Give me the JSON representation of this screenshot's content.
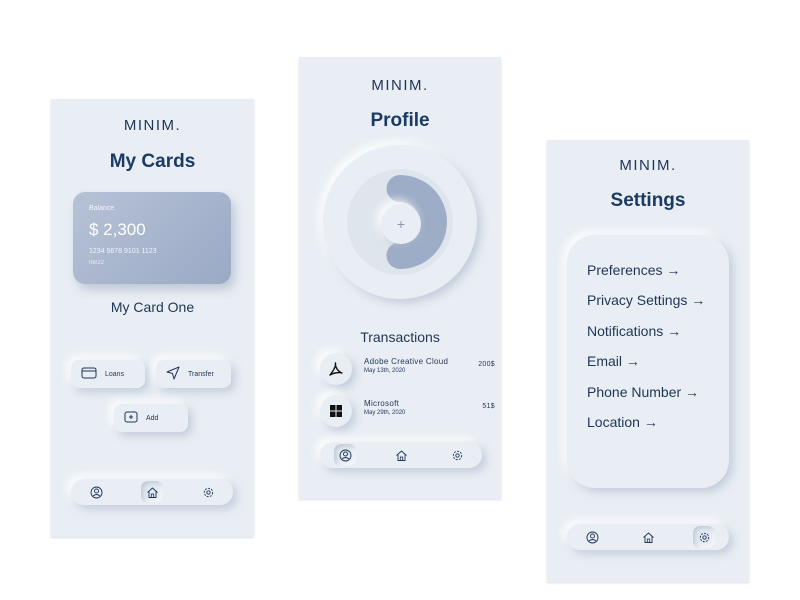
{
  "brand": "MINIM.",
  "cards_screen": {
    "title": "My Cards",
    "card": {
      "balance_label": "Balance",
      "balance_value": "$ 2,300",
      "number": "1234 5678 9101 1123",
      "expiry": "08/22"
    },
    "card_name": "My Card One",
    "buttons": {
      "loans": "Loans",
      "transfer": "Transfer",
      "add": "Add"
    }
  },
  "profile_screen": {
    "title": "Profile",
    "donut_fraction": 0.5,
    "transactions_title": "Transactions",
    "transactions": [
      {
        "name": "Adobe Creative Cloud",
        "date": "May 13th, 2020",
        "amount": "200$"
      },
      {
        "name": "Microsoft",
        "date": "May 29th, 2020",
        "amount": "51$"
      }
    ]
  },
  "settings_screen": {
    "title": "Settings",
    "items": [
      "Preferences  →",
      "Privacy Settings →",
      "Notifications →",
      "Email →",
      "Phone Number →",
      "Location →"
    ]
  },
  "colors": {
    "background": "#e9eef4",
    "text": "#1f3556",
    "accent": "#9aa9c5"
  },
  "icons": [
    "wallet-icon",
    "send-icon",
    "plus-icon",
    "user-icon",
    "home-icon",
    "gear-icon",
    "adobe-icon",
    "microsoft-icon"
  ]
}
